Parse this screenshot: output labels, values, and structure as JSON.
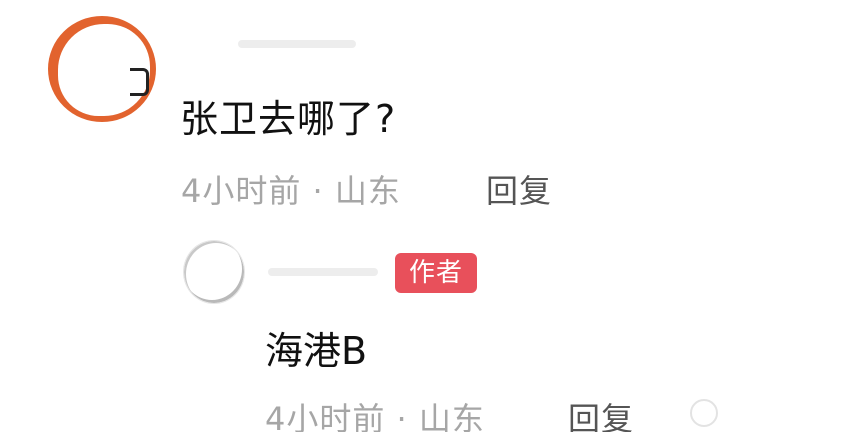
{
  "comment": {
    "text": "张卫去哪了?",
    "meta": "4小时前 · 山东",
    "reply_label": "回复",
    "avatar_color": "#e2632e"
  },
  "reply": {
    "badge": "作者",
    "badge_color": "#e8505b",
    "text": "海港B",
    "meta": "4小时前 · 山东",
    "reply_label": "回复"
  }
}
